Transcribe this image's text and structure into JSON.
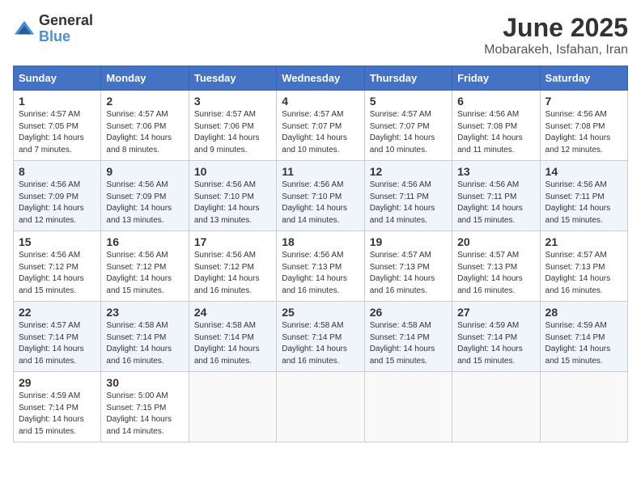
{
  "logo": {
    "general": "General",
    "blue": "Blue"
  },
  "title": "June 2025",
  "subtitle": "Mobarakeh, Isfahan, Iran",
  "days_of_week": [
    "Sunday",
    "Monday",
    "Tuesday",
    "Wednesday",
    "Thursday",
    "Friday",
    "Saturday"
  ],
  "weeks": [
    [
      {
        "day": "1",
        "sunrise": "4:57 AM",
        "sunset": "7:05 PM",
        "daylight": "14 hours and 7 minutes."
      },
      {
        "day": "2",
        "sunrise": "4:57 AM",
        "sunset": "7:06 PM",
        "daylight": "14 hours and 8 minutes."
      },
      {
        "day": "3",
        "sunrise": "4:57 AM",
        "sunset": "7:06 PM",
        "daylight": "14 hours and 9 minutes."
      },
      {
        "day": "4",
        "sunrise": "4:57 AM",
        "sunset": "7:07 PM",
        "daylight": "14 hours and 10 minutes."
      },
      {
        "day": "5",
        "sunrise": "4:57 AM",
        "sunset": "7:07 PM",
        "daylight": "14 hours and 10 minutes."
      },
      {
        "day": "6",
        "sunrise": "4:56 AM",
        "sunset": "7:08 PM",
        "daylight": "14 hours and 11 minutes."
      },
      {
        "day": "7",
        "sunrise": "4:56 AM",
        "sunset": "7:08 PM",
        "daylight": "14 hours and 12 minutes."
      }
    ],
    [
      {
        "day": "8",
        "sunrise": "4:56 AM",
        "sunset": "7:09 PM",
        "daylight": "14 hours and 12 minutes."
      },
      {
        "day": "9",
        "sunrise": "4:56 AM",
        "sunset": "7:09 PM",
        "daylight": "14 hours and 13 minutes."
      },
      {
        "day": "10",
        "sunrise": "4:56 AM",
        "sunset": "7:10 PM",
        "daylight": "14 hours and 13 minutes."
      },
      {
        "day": "11",
        "sunrise": "4:56 AM",
        "sunset": "7:10 PM",
        "daylight": "14 hours and 14 minutes."
      },
      {
        "day": "12",
        "sunrise": "4:56 AM",
        "sunset": "7:11 PM",
        "daylight": "14 hours and 14 minutes."
      },
      {
        "day": "13",
        "sunrise": "4:56 AM",
        "sunset": "7:11 PM",
        "daylight": "14 hours and 15 minutes."
      },
      {
        "day": "14",
        "sunrise": "4:56 AM",
        "sunset": "7:11 PM",
        "daylight": "14 hours and 15 minutes."
      }
    ],
    [
      {
        "day": "15",
        "sunrise": "4:56 AM",
        "sunset": "7:12 PM",
        "daylight": "14 hours and 15 minutes."
      },
      {
        "day": "16",
        "sunrise": "4:56 AM",
        "sunset": "7:12 PM",
        "daylight": "14 hours and 15 minutes."
      },
      {
        "day": "17",
        "sunrise": "4:56 AM",
        "sunset": "7:12 PM",
        "daylight": "14 hours and 16 minutes."
      },
      {
        "day": "18",
        "sunrise": "4:56 AM",
        "sunset": "7:13 PM",
        "daylight": "14 hours and 16 minutes."
      },
      {
        "day": "19",
        "sunrise": "4:57 AM",
        "sunset": "7:13 PM",
        "daylight": "14 hours and 16 minutes."
      },
      {
        "day": "20",
        "sunrise": "4:57 AM",
        "sunset": "7:13 PM",
        "daylight": "14 hours and 16 minutes."
      },
      {
        "day": "21",
        "sunrise": "4:57 AM",
        "sunset": "7:13 PM",
        "daylight": "14 hours and 16 minutes."
      }
    ],
    [
      {
        "day": "22",
        "sunrise": "4:57 AM",
        "sunset": "7:14 PM",
        "daylight": "14 hours and 16 minutes."
      },
      {
        "day": "23",
        "sunrise": "4:58 AM",
        "sunset": "7:14 PM",
        "daylight": "14 hours and 16 minutes."
      },
      {
        "day": "24",
        "sunrise": "4:58 AM",
        "sunset": "7:14 PM",
        "daylight": "14 hours and 16 minutes."
      },
      {
        "day": "25",
        "sunrise": "4:58 AM",
        "sunset": "7:14 PM",
        "daylight": "14 hours and 16 minutes."
      },
      {
        "day": "26",
        "sunrise": "4:58 AM",
        "sunset": "7:14 PM",
        "daylight": "14 hours and 15 minutes."
      },
      {
        "day": "27",
        "sunrise": "4:59 AM",
        "sunset": "7:14 PM",
        "daylight": "14 hours and 15 minutes."
      },
      {
        "day": "28",
        "sunrise": "4:59 AM",
        "sunset": "7:14 PM",
        "daylight": "14 hours and 15 minutes."
      }
    ],
    [
      {
        "day": "29",
        "sunrise": "4:59 AM",
        "sunset": "7:14 PM",
        "daylight": "14 hours and 15 minutes."
      },
      {
        "day": "30",
        "sunrise": "5:00 AM",
        "sunset": "7:15 PM",
        "daylight": "14 hours and 14 minutes."
      },
      null,
      null,
      null,
      null,
      null
    ]
  ]
}
